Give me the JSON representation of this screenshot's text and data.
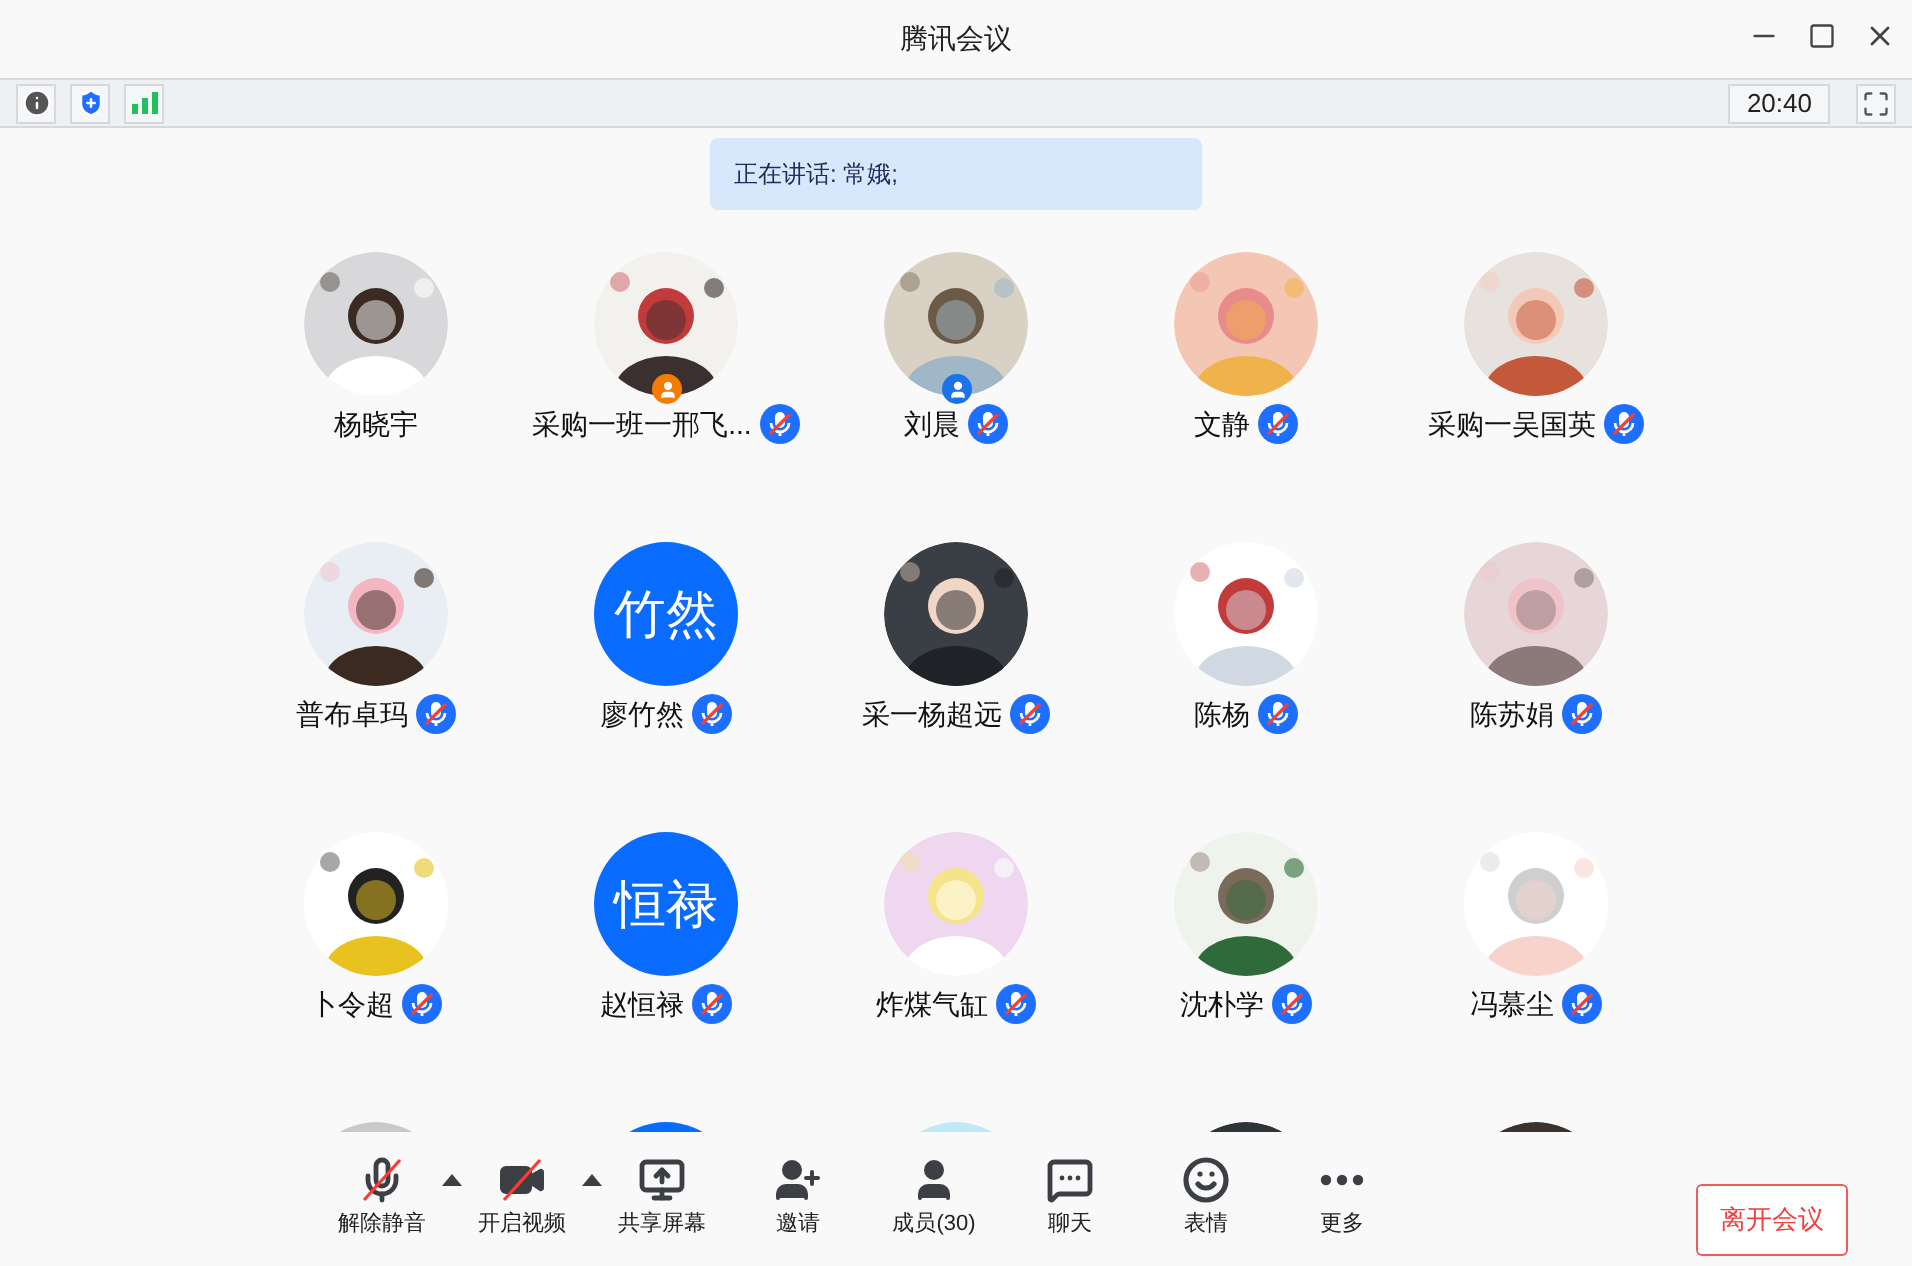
{
  "window": {
    "title": "腾讯会议"
  },
  "status_bar": {
    "time": "20:40"
  },
  "speaking": {
    "text": "正在讲话: 常娥;"
  },
  "participants": [
    {
      "name": "杨晓宇",
      "muted": false,
      "avatar": {
        "kind": "picture"
      }
    },
    {
      "name": "采购一班一邢飞...",
      "muted": true,
      "avatar": {
        "kind": "picture"
      },
      "badge": {
        "color": "#f57c00"
      }
    },
    {
      "name": "刘晨",
      "muted": true,
      "avatar": {
        "kind": "picture"
      },
      "badge": {
        "color": "#1a73e8"
      }
    },
    {
      "name": "文静",
      "muted": true,
      "avatar": {
        "kind": "picture"
      }
    },
    {
      "name": "采购一吴国英",
      "muted": true,
      "avatar": {
        "kind": "picture"
      }
    },
    {
      "name": "普布卓玛",
      "muted": true,
      "avatar": {
        "kind": "picture"
      }
    },
    {
      "name": "廖竹然",
      "muted": true,
      "avatar": {
        "kind": "initials",
        "text": "竹然"
      }
    },
    {
      "name": "采一杨超远",
      "muted": true,
      "avatar": {
        "kind": "picture"
      }
    },
    {
      "name": "陈杨",
      "muted": true,
      "avatar": {
        "kind": "picture"
      }
    },
    {
      "name": "陈苏娟",
      "muted": true,
      "avatar": {
        "kind": "picture"
      }
    },
    {
      "name": "卜令超",
      "muted": true,
      "avatar": {
        "kind": "picture"
      }
    },
    {
      "name": "赵恒禄",
      "muted": true,
      "avatar": {
        "kind": "initials",
        "text": "恒禄"
      }
    },
    {
      "name": "炸煤气缸",
      "muted": true,
      "avatar": {
        "kind": "picture"
      }
    },
    {
      "name": "沈朴学",
      "muted": true,
      "avatar": {
        "kind": "picture"
      }
    },
    {
      "name": "冯慕尘",
      "muted": true,
      "avatar": {
        "kind": "picture"
      }
    },
    {
      "avatar": {
        "kind": "picture"
      }
    },
    {
      "avatar": {
        "kind": "initials"
      }
    },
    {
      "avatar": {
        "kind": "picture"
      }
    },
    {
      "avatar": {
        "kind": "picture"
      }
    },
    {
      "avatar": {
        "kind": "picture"
      }
    }
  ],
  "toolbar": [
    {
      "kind": "mic",
      "label": "解除静音",
      "off": true,
      "has_menu": true
    },
    {
      "kind": "video",
      "label": "开启视频",
      "off": true,
      "has_menu": true
    },
    {
      "kind": "share",
      "label": "共享屏幕",
      "off": false,
      "has_menu": false
    },
    {
      "kind": "invite",
      "label": "邀请",
      "off": false,
      "has_menu": false
    },
    {
      "kind": "members",
      "label": "成员(30)",
      "off": false,
      "has_menu": false
    },
    {
      "kind": "chat",
      "label": "聊天",
      "off": false,
      "has_menu": false
    },
    {
      "kind": "emoji",
      "label": "表情",
      "off": false,
      "has_menu": false
    },
    {
      "kind": "more",
      "label": "更多",
      "off": false,
      "has_menu": false
    }
  ],
  "leave_button": {
    "label": "离开会议"
  }
}
